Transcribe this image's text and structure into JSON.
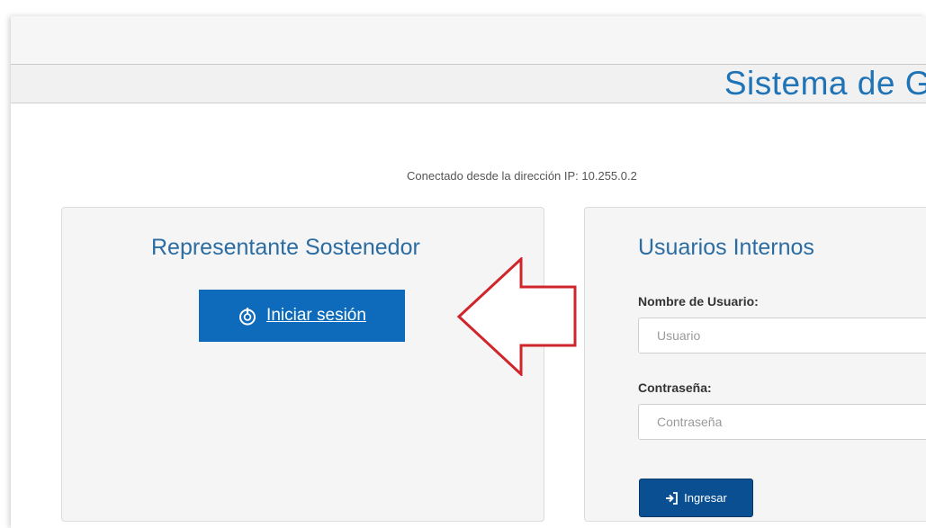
{
  "header": {
    "title": "Sistema de G"
  },
  "connection": {
    "text": "Conectado desde la dirección IP: 10.255.0.2"
  },
  "representative": {
    "title": "Representante Sostenedor",
    "login_button": {
      "label": "Iniciar sesión",
      "icon": "power-icon"
    }
  },
  "internal_users": {
    "title": "Usuarios Internos",
    "username": {
      "label": "Nombre de Usuario:",
      "placeholder": "Usuario"
    },
    "password": {
      "label": "Contraseña:",
      "placeholder": "Contraseña"
    },
    "submit": {
      "label": "Ingresar",
      "icon": "sign-in-icon"
    }
  },
  "annotation": {
    "arrow_color": "#d0262b",
    "icon": "arrow-left-icon"
  },
  "colors": {
    "accent": "#1f73b7",
    "button_primary": "#0e6bbb",
    "button_dark": "#0b4f93",
    "panel_bg": "#f5f5f5"
  }
}
